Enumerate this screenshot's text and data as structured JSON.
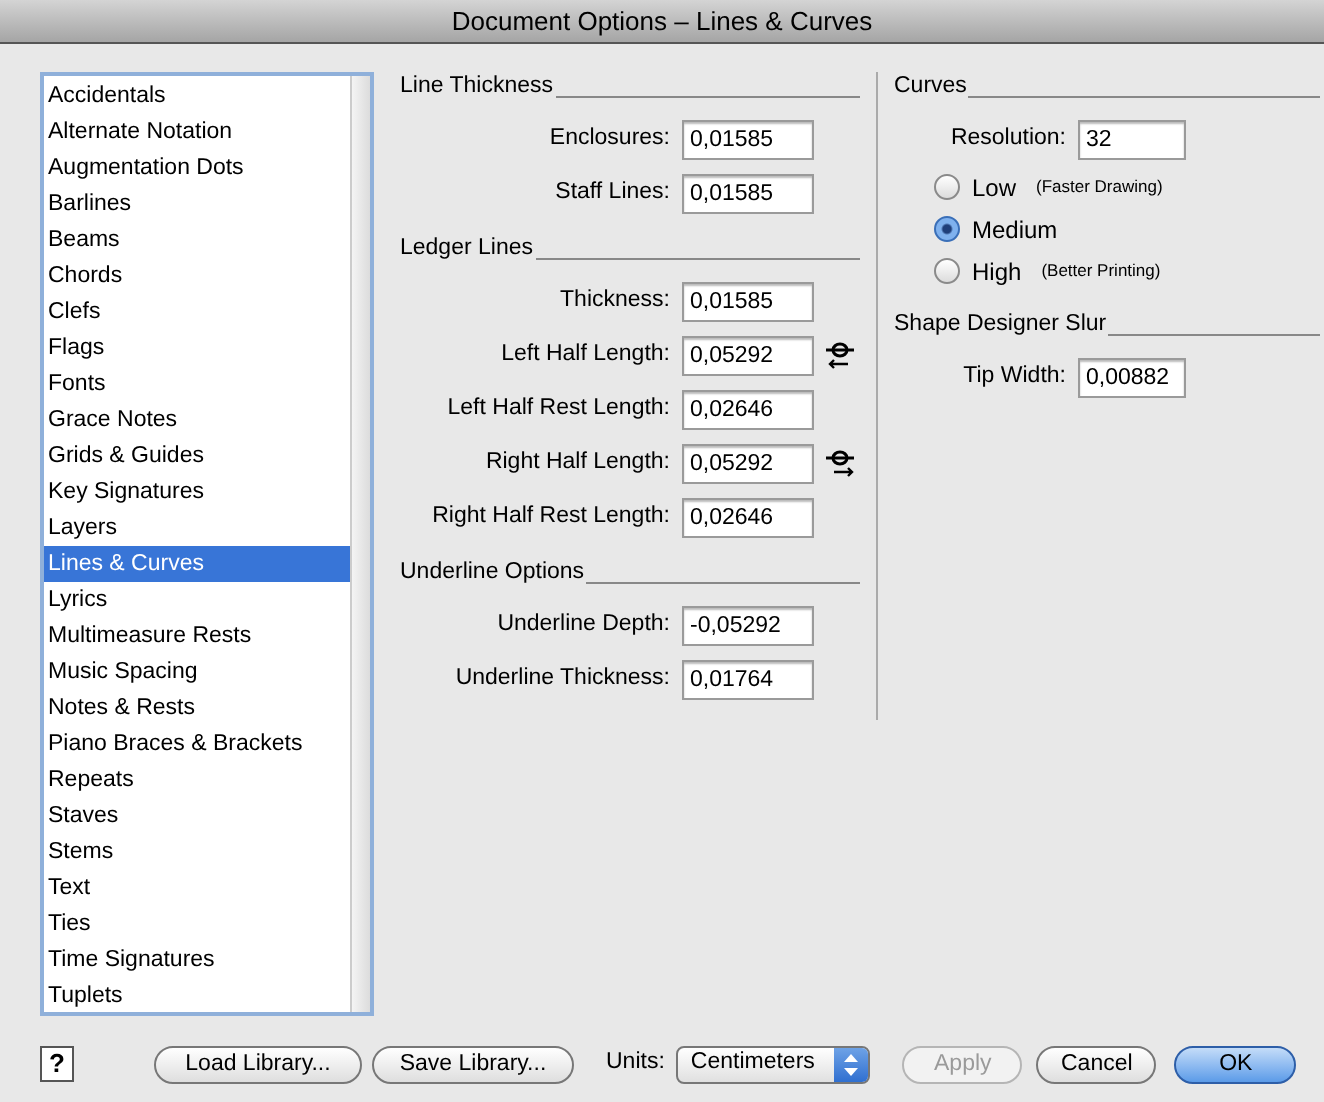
{
  "window": {
    "title": "Document Options – Lines & Curves"
  },
  "categories": [
    {
      "label": "Accidentals",
      "selected": false
    },
    {
      "label": "Alternate Notation",
      "selected": false
    },
    {
      "label": "Augmentation Dots",
      "selected": false
    },
    {
      "label": "Barlines",
      "selected": false
    },
    {
      "label": "Beams",
      "selected": false
    },
    {
      "label": "Chords",
      "selected": false
    },
    {
      "label": "Clefs",
      "selected": false
    },
    {
      "label": "Flags",
      "selected": false
    },
    {
      "label": "Fonts",
      "selected": false
    },
    {
      "label": "Grace Notes",
      "selected": false
    },
    {
      "label": "Grids & Guides",
      "selected": false
    },
    {
      "label": "Key Signatures",
      "selected": false
    },
    {
      "label": "Layers",
      "selected": false
    },
    {
      "label": "Lines & Curves",
      "selected": true
    },
    {
      "label": "Lyrics",
      "selected": false
    },
    {
      "label": "Multimeasure Rests",
      "selected": false
    },
    {
      "label": "Music Spacing",
      "selected": false
    },
    {
      "label": "Notes & Rests",
      "selected": false
    },
    {
      "label": "Piano Braces & Brackets",
      "selected": false
    },
    {
      "label": "Repeats",
      "selected": false
    },
    {
      "label": "Staves",
      "selected": false
    },
    {
      "label": "Stems",
      "selected": false
    },
    {
      "label": "Text",
      "selected": false
    },
    {
      "label": "Ties",
      "selected": false
    },
    {
      "label": "Time Signatures",
      "selected": false
    },
    {
      "label": "Tuplets",
      "selected": false
    }
  ],
  "left_sections": [
    {
      "title": "Line Thickness",
      "fields": [
        {
          "label": "Enclosures:",
          "value": "0,01585",
          "kind": "plain"
        },
        {
          "label": "Staff Lines:",
          "value": "0,01585",
          "kind": "plain"
        }
      ]
    },
    {
      "title": "Ledger Lines",
      "fields": [
        {
          "label": "Thickness:",
          "value": "0,01585",
          "kind": "plain"
        },
        {
          "label": "Left Half Length:",
          "value": "0,05292",
          "kind": "left-handle"
        },
        {
          "label": "Left Half Rest Length:",
          "value": "0,02646",
          "kind": "plain"
        },
        {
          "label": "Right Half Length:",
          "value": "0,05292",
          "kind": "right-handle"
        },
        {
          "label": "Right Half Rest Length:",
          "value": "0,02646",
          "kind": "plain"
        }
      ]
    },
    {
      "title": "Underline Options",
      "fields": [
        {
          "label": "Underline Depth:",
          "value": "-0,05292",
          "kind": "plain"
        },
        {
          "label": "Underline Thickness:",
          "value": "0,01764",
          "kind": "plain"
        }
      ]
    }
  ],
  "curves": {
    "title": "Curves",
    "resolution": {
      "label": "Resolution:",
      "value": "32"
    },
    "options": [
      {
        "label": "Low",
        "note": "(Faster Drawing)",
        "selected": false
      },
      {
        "label": "Medium",
        "selected": true
      },
      {
        "label": "High",
        "note": "(Better Printing)",
        "selected": false
      }
    ]
  },
  "slur": {
    "title": "Shape Designer Slur",
    "tip_width": {
      "label": "Tip Width:",
      "value": "0,00882"
    }
  },
  "footer": {
    "help": "?",
    "load": "Load Library...",
    "save": "Save Library...",
    "units_label": "Units:",
    "units": "Centimeters",
    "buttons": [
      {
        "label": "Apply",
        "disabled": true,
        "default": false
      },
      {
        "label": "Cancel",
        "disabled": false,
        "default": false
      },
      {
        "label": "OK",
        "disabled": false,
        "default": true
      }
    ]
  }
}
